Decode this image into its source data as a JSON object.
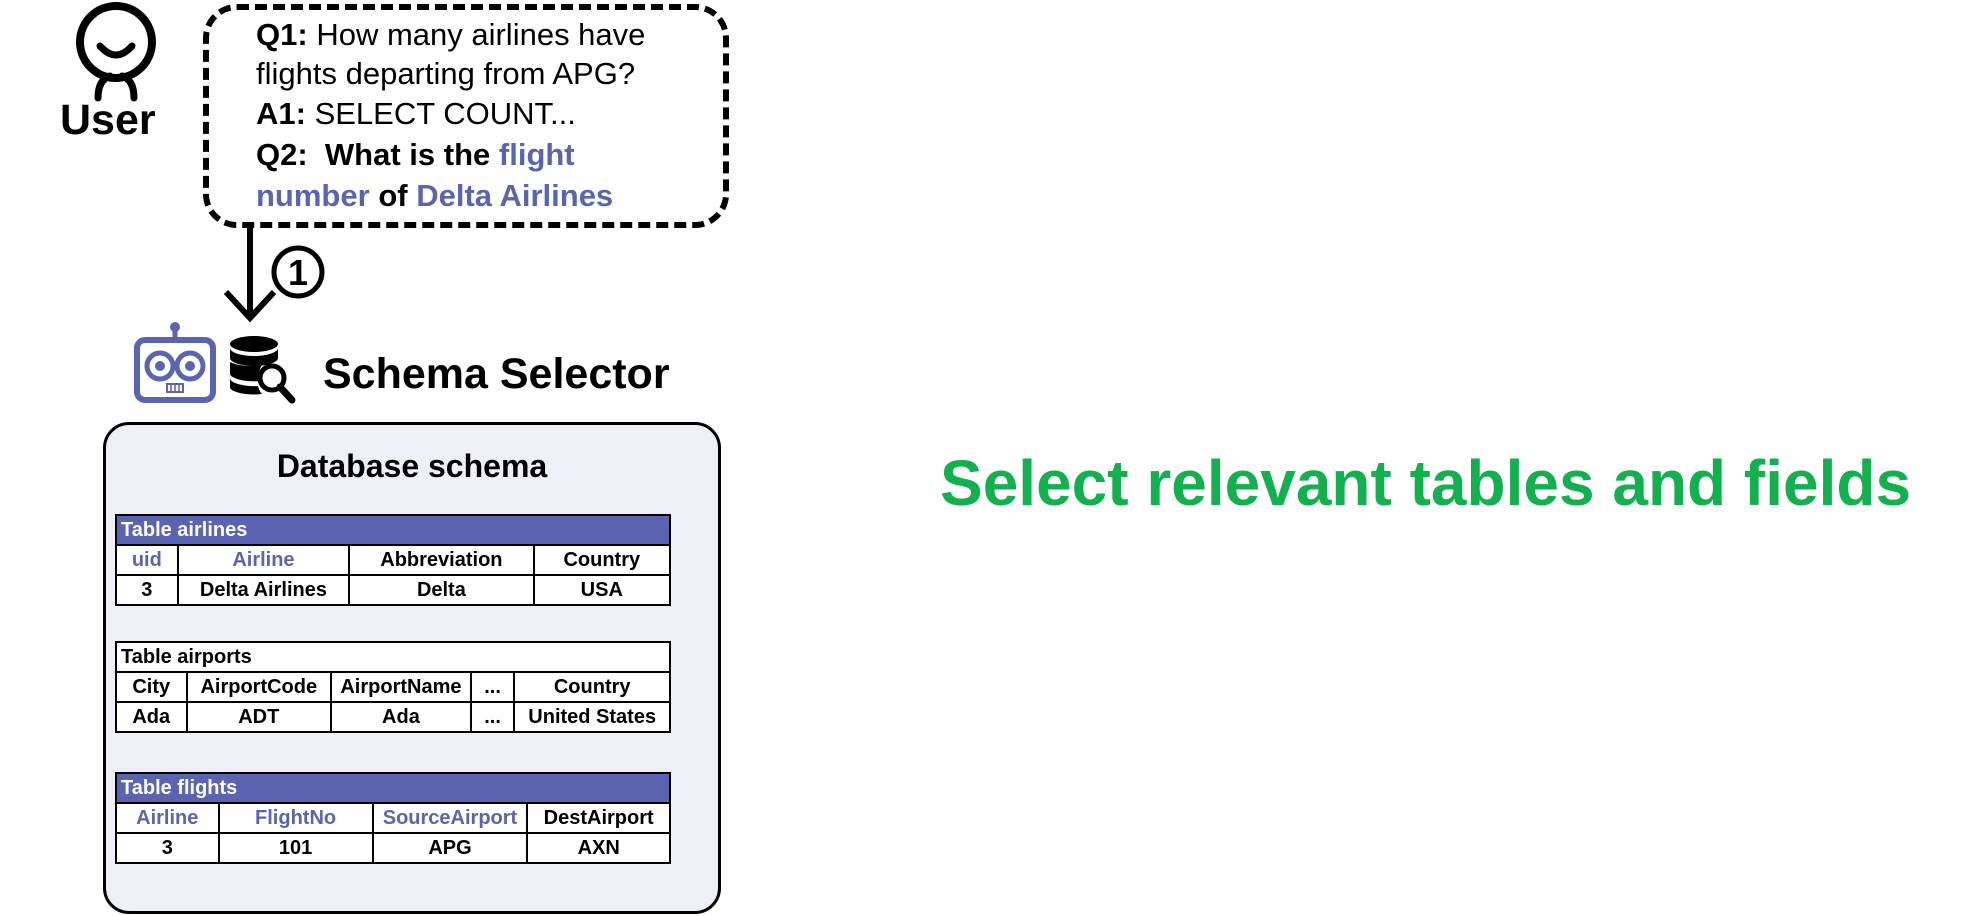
{
  "user": {
    "label": "User"
  },
  "dialogue": {
    "q1_prefix": "Q1:",
    "q1_line1": "How many airlines have",
    "q1_line2": "flights departing from APG?",
    "a1_prefix": "A1:",
    "a1_text": "SELECT COUNT...",
    "q2_prefix": "Q2:",
    "q2_part1": "What is the",
    "q2_hl1": "flight",
    "q2_hl2": "number",
    "q2_part2": "of",
    "q2_hl3": "Delta Airlines"
  },
  "step": {
    "number": "1"
  },
  "selector": {
    "title": "Schema Selector",
    "robot_icon": "robot-icon",
    "db_icon": "database-search-icon"
  },
  "schema": {
    "title": "Database schema",
    "tables": {
      "airlines": {
        "name": "Table airlines",
        "headers": [
          "uid",
          "Airline",
          "Abbreviation",
          "Country"
        ],
        "row": [
          "3",
          "Delta Airlines",
          "Delta",
          "USA"
        ]
      },
      "airports": {
        "name": "Table airports",
        "headers": [
          "City",
          "AirportCode",
          "AirportName",
          "...",
          "Country"
        ],
        "row": [
          "Ada",
          "ADT",
          "Ada",
          "...",
          "United States"
        ]
      },
      "flights": {
        "name": "Table flights",
        "headers": [
          "Airline",
          "FlightNo",
          "SourceAirport",
          "DestAirport"
        ],
        "row": [
          "3",
          "101",
          "APG",
          "AXN"
        ]
      }
    }
  },
  "caption": "Select relevant tables and fields",
  "colors": {
    "highlight": "#5b64b0",
    "caption": "#12b04e",
    "panel": "#eeeff7"
  }
}
